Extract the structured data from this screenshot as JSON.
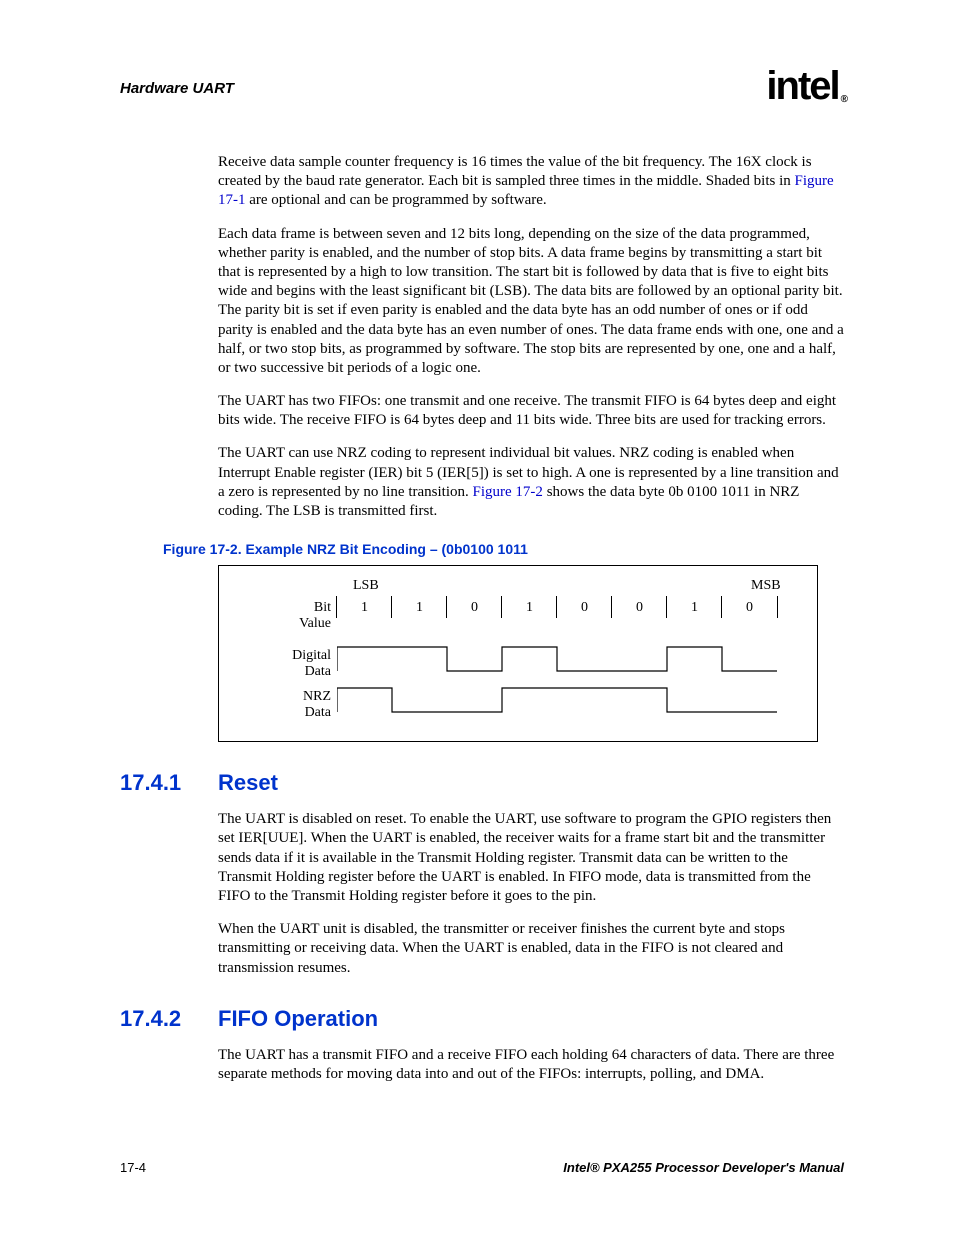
{
  "header": {
    "title": "Hardware UART",
    "logo_text": "intel",
    "logo_reg": "®"
  },
  "paragraphs": {
    "p1a": "Receive data sample counter frequency is 16 times the value of the bit frequency. The 16X clock is created by the baud rate generator. Each bit is sampled three times in the middle. Shaded bits in ",
    "p1_link": "Figure 17-1",
    "p1b": " are optional and can be programmed by software.",
    "p2": "Each data frame is between seven and 12 bits long, depending on the size of the data programmed, whether parity is enabled, and the number of stop bits. A data frame begins by transmitting a start bit that is represented by a high to low transition. The start bit is followed by data that is five to eight bits wide and begins with the least significant bit (LSB). The data bits are followed by an optional parity bit. The parity bit is set if even parity is enabled and the data byte has an odd number of ones or if odd parity is enabled and the data byte has an even number of ones. The data frame ends with one, one and a half, or two stop bits, as programmed by software. The stop bits are represented by one, one and a half, or two successive bit periods of a logic one.",
    "p3": "The UART has two FIFOs: one transmit and one receive. The transmit FIFO is 64 bytes deep and eight bits wide. The receive FIFO is 64 bytes deep and 11 bits wide. Three bits are used for tracking errors.",
    "p4a": "The UART can use NRZ coding to represent individual bit values. NRZ coding is enabled when Interrupt Enable register (IER) bit 5 (IER[5]) is set to high. A one is represented by a line transition and a zero is represented by no line transition. ",
    "p4_link": "Figure 17-2",
    "p4b": " shows the data byte 0b 0100 1011 in NRZ coding. The LSB is transmitted first."
  },
  "figure": {
    "caption": "Figure 17-2. Example NRZ Bit Encoding – (0b0100 1011",
    "lsb": "LSB",
    "msb": "MSB",
    "row_bit": "Bit Value",
    "row_digital": "Digital Data",
    "row_nrz": "NRZ Data",
    "bits": [
      "1",
      "1",
      "0",
      "1",
      "0",
      "0",
      "1",
      "0"
    ]
  },
  "sections": {
    "s1_num": "17.4.1",
    "s1_title": "Reset",
    "s1_p1": "The UART is disabled on reset. To enable the UART, use software to program the GPIO registers then set IER[UUE]. When the UART is enabled, the receiver waits for a frame start bit and the transmitter sends data if it is available in the Transmit Holding register. Transmit data can be written to the Transmit Holding register before the UART is enabled. In FIFO mode, data is transmitted from the FIFO to the Transmit Holding register before it goes to the pin.",
    "s1_p2": "When the UART unit is disabled, the transmitter or receiver finishes the current byte and stops transmitting or receiving data. When the UART is enabled, data in the FIFO is not cleared and transmission resumes.",
    "s2_num": "17.4.2",
    "s2_title": "FIFO Operation",
    "s2_p1": "The UART has a transmit FIFO and a receive FIFO each holding 64 characters of data. There are three separate methods for moving data into and out of the FIFOs: interrupts, polling, and DMA."
  },
  "footer": {
    "left": "17-4",
    "right": "Intel® PXA255 Processor Developer's Manual"
  }
}
